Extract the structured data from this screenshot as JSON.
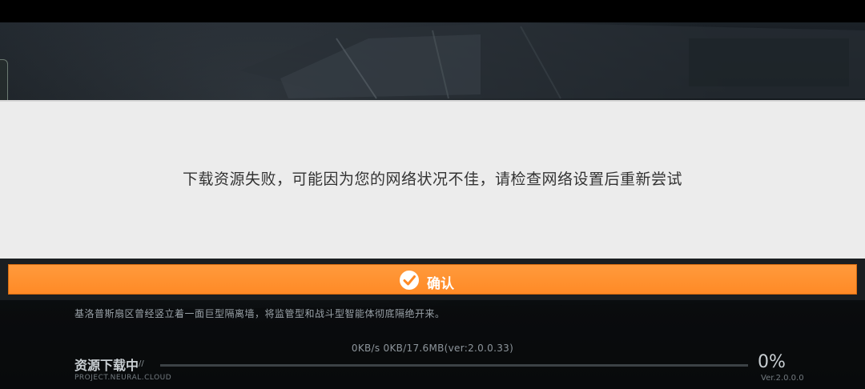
{
  "dialog": {
    "message": "下载资源失败，可能因为您的网络状况不佳，请检查网络设置后重新尝试",
    "confirm_label": "确认"
  },
  "loading": {
    "lore": "基洛普斯扇区曾经竖立着一面巨型隔离墙，将监管型和战斗型智能体彻底隔绝开来。",
    "speed_text": "0KB/s 0KB/17.6MB(ver:2.0.0.33)",
    "title": "资源下载中",
    "title_suffix": "//",
    "subtitle": "PROJECT.NEURAL.CLOUD",
    "percent": "0%",
    "progress": 0,
    "version": "Ver.2.0.0.0"
  },
  "colors": {
    "accent": "#ff8a26",
    "dialog_bg": "#ececec",
    "message_text": "#333333"
  },
  "icons": {
    "confirm": "check-circle-icon"
  }
}
